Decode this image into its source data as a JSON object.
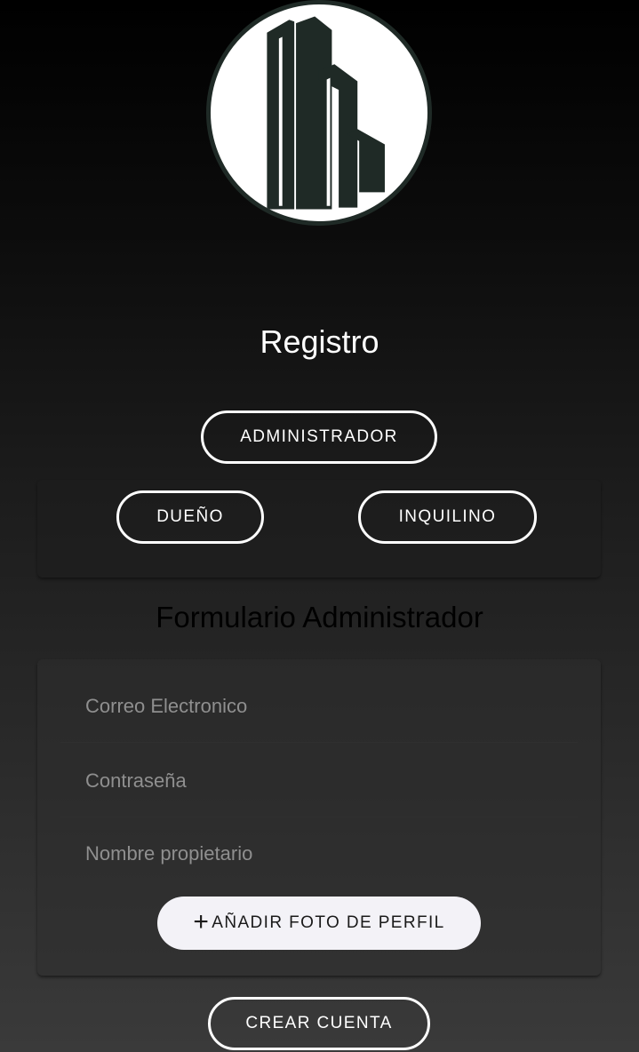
{
  "header": {
    "logo_icon": "building-logo-icon",
    "title": "Registro"
  },
  "roles": {
    "admin_label": "ADMINISTRADOR",
    "owner_label": "DUEÑO",
    "tenant_label": "INQUILINO"
  },
  "form": {
    "title": "Formulario Administrador",
    "email_placeholder": "Correo Electronico",
    "password_placeholder": "Contraseña",
    "owner_name_placeholder": "Nombre propietario",
    "add_photo_icon": "plus-icon",
    "add_photo_plus": "+",
    "add_photo_label": "AÑADIR FOTO DE PERFIL"
  },
  "actions": {
    "create_account_label": "CREAR CUENTA"
  },
  "colors": {
    "background_top": "#000000",
    "background_bottom": "#3a3a3a",
    "outline_button": "#ffffff",
    "photo_button_bg": "#f3f2f7",
    "logo_dark": "#1f2a26"
  }
}
